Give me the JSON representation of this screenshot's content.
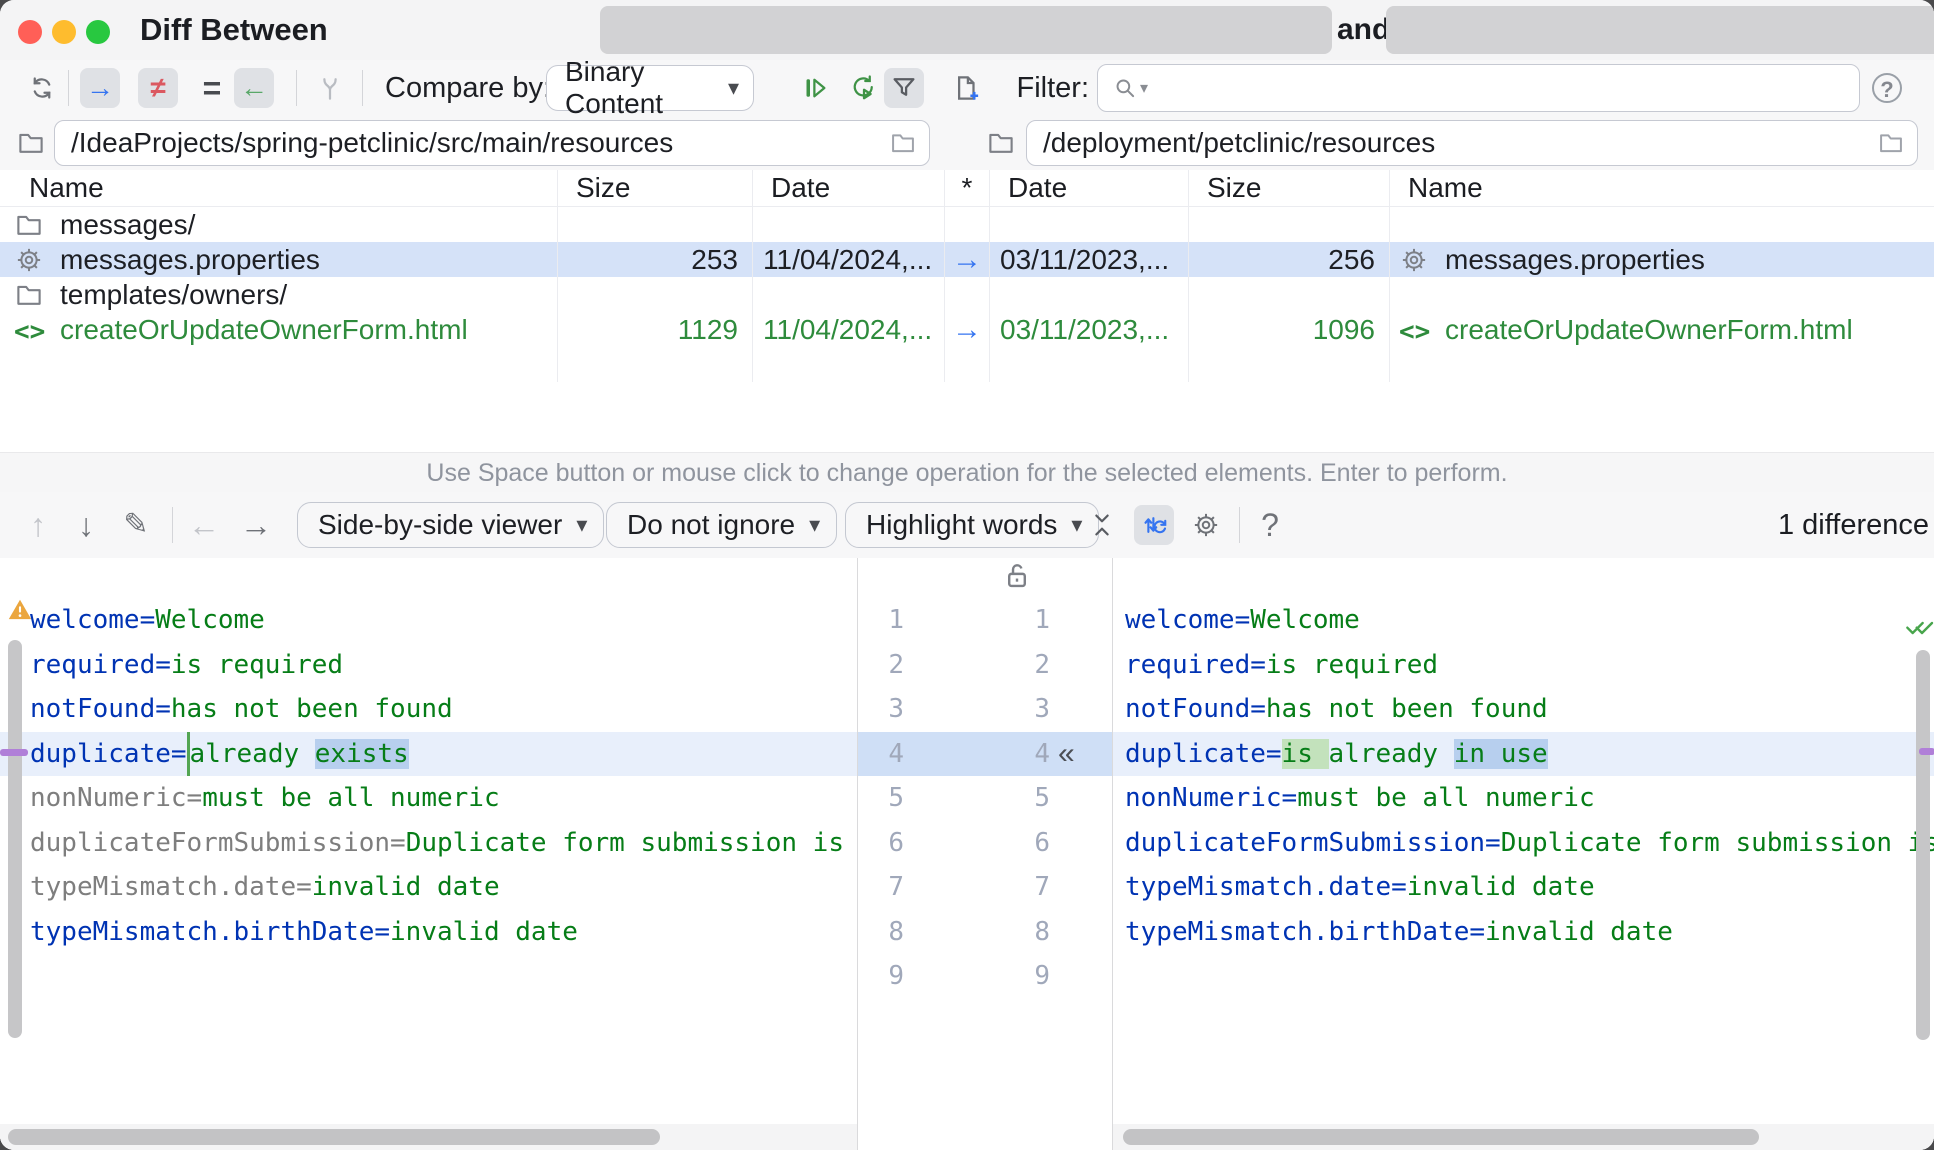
{
  "window": {
    "title": "Diff Between",
    "and_label": "and"
  },
  "glyphs": {
    "arrow_right": "→",
    "arrow_left": "←",
    "not_equal": "≠",
    "equals": "=",
    "arrow_up": "↑",
    "arrow_down": "↓",
    "pencil": "✎",
    "chevron_down": "▾",
    "double_chevron_left": "«",
    "question_mark": "?"
  },
  "toolbar": {
    "compare_by_label": "Compare by:",
    "compare_by_value": "Binary Content",
    "filter_label": "Filter:"
  },
  "paths": {
    "left": "/IdeaProjects/spring-petclinic/src/main/resources",
    "right": "/deployment/petclinic/resources"
  },
  "table": {
    "headers": {
      "name_left": "Name",
      "size_left": "Size",
      "date_left": "Date",
      "star": "*",
      "date_right": "Date",
      "size_right": "Size",
      "name_right": "Name"
    },
    "rows": [
      {
        "type": "folder",
        "left_name": "messages/"
      },
      {
        "type": "file",
        "icon": "gear",
        "selected": true,
        "left_name": "messages.properties",
        "left_size": "253",
        "left_date": "11/04/2024,...",
        "op": "→",
        "right_date": "03/11/2023,...",
        "right_size": "256",
        "right_name": "messages.properties"
      },
      {
        "type": "folder",
        "left_name": "templates/owners/"
      },
      {
        "type": "file",
        "icon": "code",
        "green": true,
        "left_name": "createOrUpdateOwnerForm.html",
        "left_size": "1129",
        "left_date": "11/04/2024,...",
        "op": "→",
        "right_date": "03/11/2023,...",
        "right_size": "1096",
        "right_name": "createOrUpdateOwnerForm.html"
      },
      {
        "type": "empty"
      }
    ],
    "hint": "Use Space button or mouse click to change operation for the selected elements. Enter to perform."
  },
  "diff_toolbar": {
    "viewer_value": "Side-by-side viewer",
    "ignore_value": "Do not ignore",
    "highlight_value": "Highlight words",
    "differences_label": "1 difference"
  },
  "diff": {
    "selected_row": 4,
    "gutter_numbers": [
      "1",
      "2",
      "3",
      "4",
      "5",
      "6",
      "7",
      "8",
      "9"
    ],
    "left_lines": [
      [
        {
          "t": "welcome=",
          "c": "k"
        },
        {
          "t": "Welcome",
          "c": "v"
        }
      ],
      [
        {
          "t": "required=",
          "c": "k"
        },
        {
          "t": "is required",
          "c": "v"
        }
      ],
      [
        {
          "t": "notFound=",
          "c": "k"
        },
        {
          "t": "has not been found",
          "c": "v"
        }
      ],
      [
        {
          "t": "duplicate=",
          "c": "k"
        },
        {
          "t": "",
          "c": "ins"
        },
        {
          "t": "already ",
          "c": "v"
        },
        {
          "t": "exists",
          "c": "v wb"
        }
      ],
      [
        {
          "t": "nonNumeric=",
          "c": "kg"
        },
        {
          "t": "must be all numeric",
          "c": "v"
        }
      ],
      [
        {
          "t": "duplicateFormSubmission=",
          "c": "kg"
        },
        {
          "t": "Duplicate form submission is",
          "c": "v"
        }
      ],
      [
        {
          "t": "typeMismatch.date=",
          "c": "kg"
        },
        {
          "t": "invalid date",
          "c": "v"
        }
      ],
      [
        {
          "t": "typeMismatch.birthDate=",
          "c": "k"
        },
        {
          "t": "invalid date",
          "c": "v"
        }
      ]
    ],
    "right_lines": [
      [
        {
          "t": "welcome=",
          "c": "k"
        },
        {
          "t": "Welcome",
          "c": "v"
        }
      ],
      [
        {
          "t": "required=",
          "c": "k"
        },
        {
          "t": "is required",
          "c": "v"
        }
      ],
      [
        {
          "t": "notFound=",
          "c": "k"
        },
        {
          "t": "has not been found",
          "c": "v"
        }
      ],
      [
        {
          "t": "duplicate=",
          "c": "k"
        },
        {
          "t": "is ",
          "c": "v wg"
        },
        {
          "t": "already ",
          "c": "v"
        },
        {
          "t": "in use",
          "c": "v wb"
        }
      ],
      [
        {
          "t": "nonNumeric=",
          "c": "k"
        },
        {
          "t": "must be all numeric",
          "c": "v"
        }
      ],
      [
        {
          "t": "duplicateFormSubmission=",
          "c": "k"
        },
        {
          "t": "Duplicate form submission is",
          "c": "v"
        }
      ],
      [
        {
          "t": "typeMismatch.date=",
          "c": "k"
        },
        {
          "t": "invalid date",
          "c": "v"
        }
      ],
      [
        {
          "t": "typeMismatch.birthDate=",
          "c": "k"
        },
        {
          "t": "invalid date",
          "c": "v"
        }
      ]
    ]
  },
  "colors": {
    "accent_blue": "#3574f0",
    "action_green": "#59a869",
    "action_red": "#db5860",
    "key_navy": "#0033b3",
    "value_green": "#067d17",
    "table_green": "#2e8b3c",
    "selection_blue": "#d5e2f8",
    "diff_line_blue": "#e8effb",
    "word_blue": "#b7cfee",
    "word_green": "#c3e2bc",
    "stripe_purple": "#b07fd8",
    "warning_amber": "#eba63e"
  }
}
